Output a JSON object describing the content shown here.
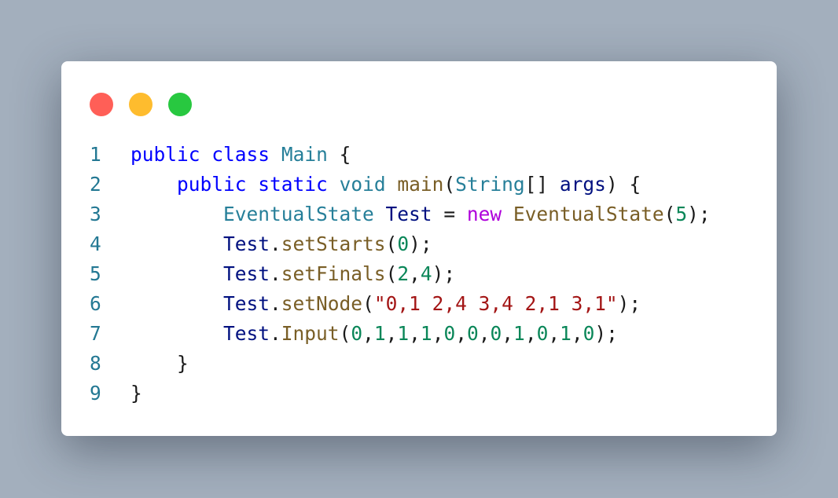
{
  "window": {
    "controls": [
      "close",
      "minimize",
      "maximize"
    ],
    "colors": {
      "close": "#ff5f57",
      "minimize": "#febc2e",
      "maximize": "#28c840"
    }
  },
  "code": {
    "language": "java",
    "lines": [
      {
        "number": "1",
        "tokens": [
          {
            "t": "kw",
            "v": "public"
          },
          {
            "t": "pun",
            "v": " "
          },
          {
            "t": "kw",
            "v": "class"
          },
          {
            "t": "pun",
            "v": " "
          },
          {
            "t": "cls",
            "v": "Main"
          },
          {
            "t": "pun",
            "v": " {"
          }
        ]
      },
      {
        "number": "2",
        "tokens": [
          {
            "t": "pun",
            "v": "    "
          },
          {
            "t": "kw",
            "v": "public"
          },
          {
            "t": "pun",
            "v": " "
          },
          {
            "t": "kw",
            "v": "static"
          },
          {
            "t": "pun",
            "v": " "
          },
          {
            "t": "cls",
            "v": "void"
          },
          {
            "t": "pun",
            "v": " "
          },
          {
            "t": "fn",
            "v": "main"
          },
          {
            "t": "pun",
            "v": "("
          },
          {
            "t": "cls",
            "v": "String"
          },
          {
            "t": "pun",
            "v": "[] "
          },
          {
            "t": "var",
            "v": "args"
          },
          {
            "t": "pun",
            "v": ") {"
          }
        ]
      },
      {
        "number": "3",
        "tokens": [
          {
            "t": "pun",
            "v": "        "
          },
          {
            "t": "cls",
            "v": "EventualState"
          },
          {
            "t": "pun",
            "v": " "
          },
          {
            "t": "var",
            "v": "Test"
          },
          {
            "t": "pun",
            "v": " = "
          },
          {
            "t": "ctl",
            "v": "new"
          },
          {
            "t": "pun",
            "v": " "
          },
          {
            "t": "fn",
            "v": "EventualState"
          },
          {
            "t": "pun",
            "v": "("
          },
          {
            "t": "num",
            "v": "5"
          },
          {
            "t": "pun",
            "v": ");"
          }
        ]
      },
      {
        "number": "4",
        "tokens": [
          {
            "t": "pun",
            "v": "        "
          },
          {
            "t": "var",
            "v": "Test"
          },
          {
            "t": "pun",
            "v": "."
          },
          {
            "t": "fn",
            "v": "setStarts"
          },
          {
            "t": "pun",
            "v": "("
          },
          {
            "t": "num",
            "v": "0"
          },
          {
            "t": "pun",
            "v": ");"
          }
        ]
      },
      {
        "number": "5",
        "tokens": [
          {
            "t": "pun",
            "v": "        "
          },
          {
            "t": "var",
            "v": "Test"
          },
          {
            "t": "pun",
            "v": "."
          },
          {
            "t": "fn",
            "v": "setFinals"
          },
          {
            "t": "pun",
            "v": "("
          },
          {
            "t": "num",
            "v": "2"
          },
          {
            "t": "pun",
            "v": ","
          },
          {
            "t": "num",
            "v": "4"
          },
          {
            "t": "pun",
            "v": ");"
          }
        ]
      },
      {
        "number": "6",
        "tokens": [
          {
            "t": "pun",
            "v": "        "
          },
          {
            "t": "var",
            "v": "Test"
          },
          {
            "t": "pun",
            "v": "."
          },
          {
            "t": "fn",
            "v": "setNode"
          },
          {
            "t": "pun",
            "v": "("
          },
          {
            "t": "str",
            "v": "\"0,1 2,4 3,4 2,1 3,1\""
          },
          {
            "t": "pun",
            "v": ");"
          }
        ]
      },
      {
        "number": "7",
        "tokens": [
          {
            "t": "pun",
            "v": "        "
          },
          {
            "t": "var",
            "v": "Test"
          },
          {
            "t": "pun",
            "v": "."
          },
          {
            "t": "fn",
            "v": "Input"
          },
          {
            "t": "pun",
            "v": "("
          },
          {
            "t": "num",
            "v": "0"
          },
          {
            "t": "pun",
            "v": ","
          },
          {
            "t": "num",
            "v": "1"
          },
          {
            "t": "pun",
            "v": ","
          },
          {
            "t": "num",
            "v": "1"
          },
          {
            "t": "pun",
            "v": ","
          },
          {
            "t": "num",
            "v": "1"
          },
          {
            "t": "pun",
            "v": ","
          },
          {
            "t": "num",
            "v": "0"
          },
          {
            "t": "pun",
            "v": ","
          },
          {
            "t": "num",
            "v": "0"
          },
          {
            "t": "pun",
            "v": ","
          },
          {
            "t": "num",
            "v": "0"
          },
          {
            "t": "pun",
            "v": ","
          },
          {
            "t": "num",
            "v": "1"
          },
          {
            "t": "pun",
            "v": ","
          },
          {
            "t": "num",
            "v": "0"
          },
          {
            "t": "pun",
            "v": ","
          },
          {
            "t": "num",
            "v": "1"
          },
          {
            "t": "pun",
            "v": ","
          },
          {
            "t": "num",
            "v": "0"
          },
          {
            "t": "pun",
            "v": ");"
          }
        ]
      },
      {
        "number": "8",
        "tokens": [
          {
            "t": "pun",
            "v": "    }"
          }
        ]
      },
      {
        "number": "9",
        "tokens": [
          {
            "t": "pun",
            "v": "}"
          }
        ]
      }
    ]
  }
}
